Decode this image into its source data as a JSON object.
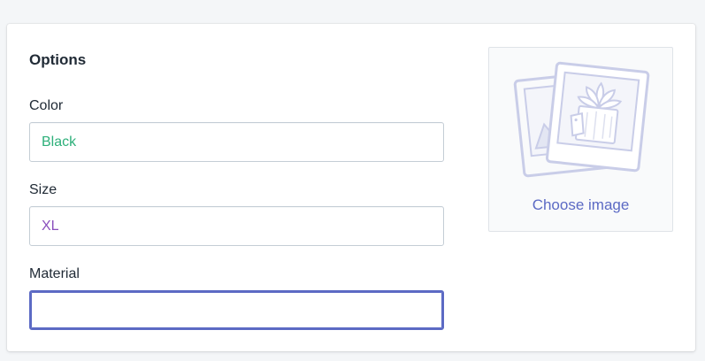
{
  "options": {
    "title": "Options",
    "fields": {
      "color": {
        "label": "Color",
        "value": "Black",
        "value_color": "#2eb07a"
      },
      "size": {
        "label": "Size",
        "value": "XL",
        "value_color": "#8a4fbd"
      },
      "material": {
        "label": "Material",
        "value": "",
        "state": "focused"
      }
    }
  },
  "image_picker": {
    "label": "Choose image",
    "icon": "photos-placeholder-icon",
    "accent": "#5c6ac4"
  },
  "colors": {
    "page_background": "#f4f6f8",
    "focus_border": "#5c6ac4"
  }
}
